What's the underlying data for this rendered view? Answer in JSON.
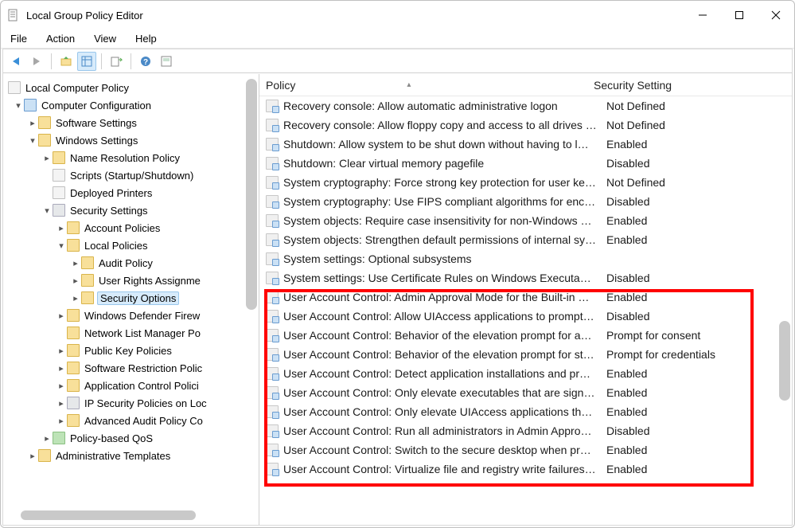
{
  "window": {
    "title": "Local Group Policy Editor"
  },
  "menu": {
    "file": "File",
    "action": "Action",
    "view": "View",
    "help": "Help"
  },
  "tree": {
    "root": "Local Computer Policy",
    "computer_config": "Computer Configuration",
    "software_settings": "Software Settings",
    "windows_settings": "Windows Settings",
    "name_resolution": "Name Resolution Policy",
    "scripts": "Scripts (Startup/Shutdown)",
    "deployed_printers": "Deployed Printers",
    "security_settings": "Security Settings",
    "account_policies": "Account Policies",
    "local_policies": "Local Policies",
    "audit_policy": "Audit Policy",
    "user_rights": "User Rights Assignme",
    "security_options": "Security Options",
    "defender_firewall": "Windows Defender Firew",
    "network_list": "Network List Manager Po",
    "public_key": "Public Key Policies",
    "software_restriction": "Software Restriction Polic",
    "app_control": "Application Control Polici",
    "ip_security": "IP Security Policies on Loc",
    "advanced_audit": "Advanced Audit Policy Co",
    "policy_qos": "Policy-based QoS",
    "admin_templates": "Administrative Templates"
  },
  "columns": {
    "policy": "Policy",
    "setting": "Security Setting"
  },
  "policies": [
    {
      "name": "Recovery console: Allow automatic administrative logon",
      "setting": "Not Defined"
    },
    {
      "name": "Recovery console: Allow floppy copy and access to all drives a…",
      "setting": "Not Defined"
    },
    {
      "name": "Shutdown: Allow system to be shut down without having to l…",
      "setting": "Enabled"
    },
    {
      "name": "Shutdown: Clear virtual memory pagefile",
      "setting": "Disabled"
    },
    {
      "name": "System cryptography: Force strong key protection for user ke…",
      "setting": "Not Defined"
    },
    {
      "name": "System cryptography: Use FIPS compliant algorithms for encr…",
      "setting": "Disabled"
    },
    {
      "name": "System objects: Require case insensitivity for non-Windows s…",
      "setting": "Enabled"
    },
    {
      "name": "System objects: Strengthen default permissions of internal sy…",
      "setting": "Enabled"
    },
    {
      "name": "System settings: Optional subsystems",
      "setting": ""
    },
    {
      "name": "System settings: Use Certificate Rules on Windows Executable…",
      "setting": "Disabled"
    },
    {
      "name": "User Account Control: Admin Approval Mode for the Built-in …",
      "setting": "Enabled"
    },
    {
      "name": "User Account Control: Allow UIAccess applications to prompt …",
      "setting": "Disabled"
    },
    {
      "name": "User Account Control: Behavior of the elevation prompt for a…",
      "setting": "Prompt for consent"
    },
    {
      "name": "User Account Control: Behavior of the elevation prompt for st…",
      "setting": "Prompt for credentials"
    },
    {
      "name": "User Account Control: Detect application installations and pr…",
      "setting": "Enabled"
    },
    {
      "name": "User Account Control: Only elevate executables that are signe…",
      "setting": "Enabled"
    },
    {
      "name": "User Account Control: Only elevate UIAccess applications that…",
      "setting": "Enabled"
    },
    {
      "name": "User Account Control: Run all administrators in Admin Appro…",
      "setting": "Disabled"
    },
    {
      "name": "User Account Control: Switch to the secure desktop when pro…",
      "setting": "Enabled"
    },
    {
      "name": "User Account Control: Virtualize file and registry write failures…",
      "setting": "Enabled"
    }
  ]
}
